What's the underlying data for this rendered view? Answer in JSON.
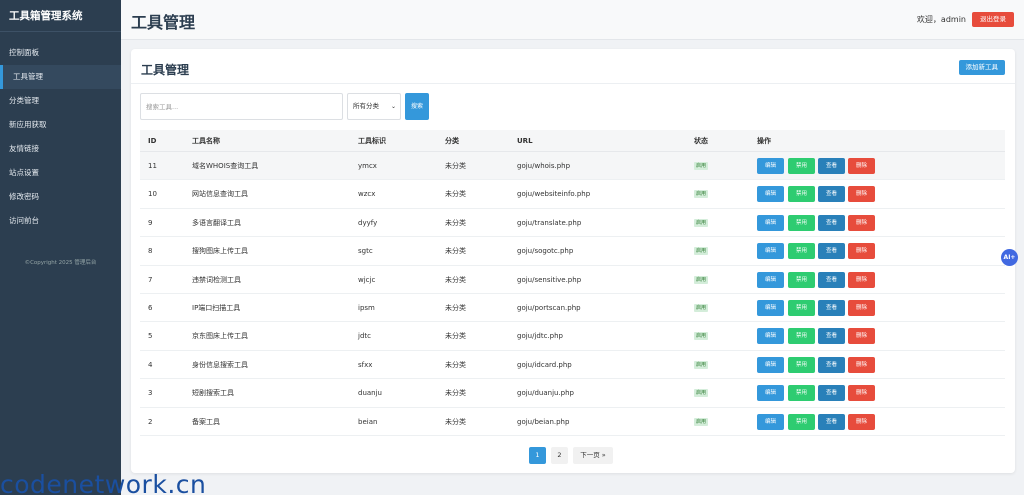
{
  "sidebar": {
    "brand": "工具箱管理系统",
    "items": [
      {
        "label": "控制面板",
        "active": false
      },
      {
        "label": "工具管理",
        "active": true
      },
      {
        "label": "分类管理",
        "active": false
      },
      {
        "label": "新应用获取",
        "active": false
      },
      {
        "label": "友情链接",
        "active": false
      },
      {
        "label": "站点设置",
        "active": false
      },
      {
        "label": "修改密码",
        "active": false
      },
      {
        "label": "访问前台",
        "active": false
      }
    ],
    "copyright": "©Copyright 2025 管理后台"
  },
  "header": {
    "title": "工具管理",
    "welcome": "欢迎，admin",
    "logout": "退出登录"
  },
  "card": {
    "title": "工具管理",
    "add_button": "添加新工具",
    "search_placeholder": "搜索工具...",
    "category_select": "所有分类",
    "search_button": "搜索"
  },
  "table": {
    "headers": {
      "id": "ID",
      "name": "工具名称",
      "key": "工具标识",
      "category": "分类",
      "url": "URL",
      "status": "状态",
      "ops": "操作"
    },
    "rows": [
      {
        "id": "11",
        "name": "域名WHOIS查询工具",
        "key": "ymcx",
        "category": "未分类",
        "url": "goju/whois.php",
        "status": "启用"
      },
      {
        "id": "10",
        "name": "网站信息查询工具",
        "key": "wzcx",
        "category": "未分类",
        "url": "goju/websiteinfo.php",
        "status": "启用"
      },
      {
        "id": "9",
        "name": "多语言翻译工具",
        "key": "dyyfy",
        "category": "未分类",
        "url": "goju/translate.php",
        "status": "启用"
      },
      {
        "id": "8",
        "name": "搜狗图床上传工具",
        "key": "sgtc",
        "category": "未分类",
        "url": "goju/sogotc.php",
        "status": "启用"
      },
      {
        "id": "7",
        "name": "违禁词检测工具",
        "key": "wjcjc",
        "category": "未分类",
        "url": "goju/sensitive.php",
        "status": "启用"
      },
      {
        "id": "6",
        "name": "IP端口扫描工具",
        "key": "ipsm",
        "category": "未分类",
        "url": "goju/portscan.php",
        "status": "启用"
      },
      {
        "id": "5",
        "name": "京东图床上传工具",
        "key": "jdtc",
        "category": "未分类",
        "url": "goju/jdtc.php",
        "status": "启用"
      },
      {
        "id": "4",
        "name": "身份信息搜索工具",
        "key": "sfxx",
        "category": "未分类",
        "url": "goju/idcard.php",
        "status": "启用"
      },
      {
        "id": "3",
        "name": "短剧搜索工具",
        "key": "duanju",
        "category": "未分类",
        "url": "goju/duanju.php",
        "status": "启用"
      },
      {
        "id": "2",
        "name": "备案工具",
        "key": "beian",
        "category": "未分类",
        "url": "goju/beian.php",
        "status": "启用"
      }
    ],
    "actions": {
      "edit": "编辑",
      "disable": "禁用",
      "view": "查看",
      "delete": "删除"
    }
  },
  "pagination": {
    "pages": [
      "1",
      "2"
    ],
    "current": "1",
    "next": "下一页 »"
  },
  "floating": {
    "ai_label": "AI+"
  },
  "watermark": "codenetwork.cn"
}
